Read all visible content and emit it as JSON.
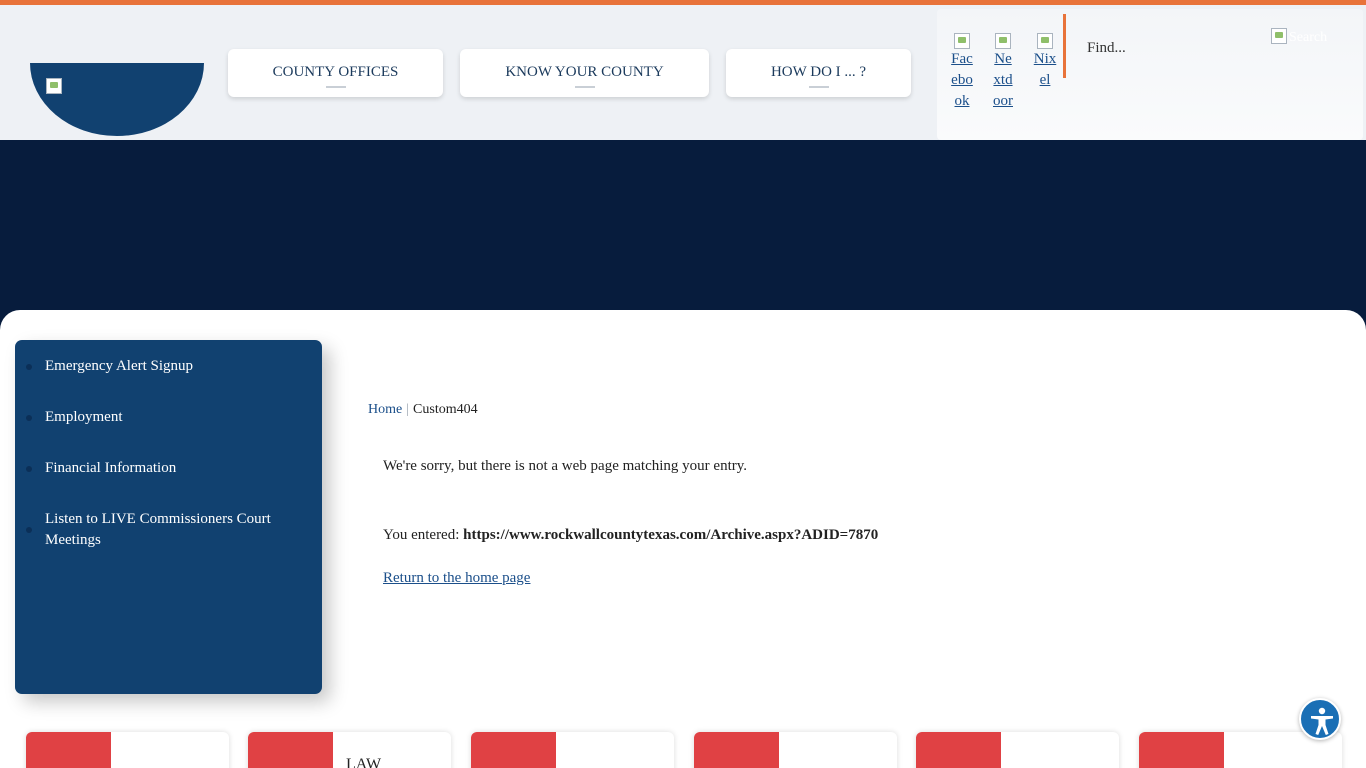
{
  "header": {
    "logo_alt": "",
    "nav": [
      {
        "label": "COUNTY OFFICES"
      },
      {
        "label": "KNOW YOUR COUNTY"
      },
      {
        "label": "HOW DO I ... ?"
      }
    ],
    "social": [
      {
        "label": "Facebook",
        "icon": "facebook-icon"
      },
      {
        "label": "Nextdoor",
        "icon": "nextdoor-icon"
      },
      {
        "label": "Nixel",
        "icon": "nixle-icon"
      }
    ],
    "search": {
      "placeholder": "Find...",
      "button_alt": "Search"
    }
  },
  "sidebar": {
    "items": [
      {
        "label": "Emergency Alert Signup"
      },
      {
        "label": "Employment"
      },
      {
        "label": "Financial Information"
      },
      {
        "label": "Listen to LIVE Commissioners Court Meetings"
      }
    ]
  },
  "breadcrumb": {
    "home": "Home",
    "separator": "|",
    "current": "Custom404"
  },
  "message": {
    "sorry": "We're sorry, but there is not a web page matching your entry.",
    "entered_label": "You entered:",
    "entered_url": "https://www.rockwallcountytexas.com/Archive.aspx?ADID=7870",
    "return_link": "Return to the home page"
  },
  "cards": [
    {
      "label": ""
    },
    {
      "label": "LAW"
    },
    {
      "label": ""
    },
    {
      "label": ""
    },
    {
      "label": ""
    },
    {
      "label": ""
    }
  ],
  "colors": {
    "accent_orange": "#e8733a",
    "navy": "#071c3d",
    "sidebar_blue": "#114170",
    "card_red": "#e04144",
    "link_blue": "#1b4f8a"
  },
  "icons": {
    "accessibility": "accessibility-icon"
  }
}
